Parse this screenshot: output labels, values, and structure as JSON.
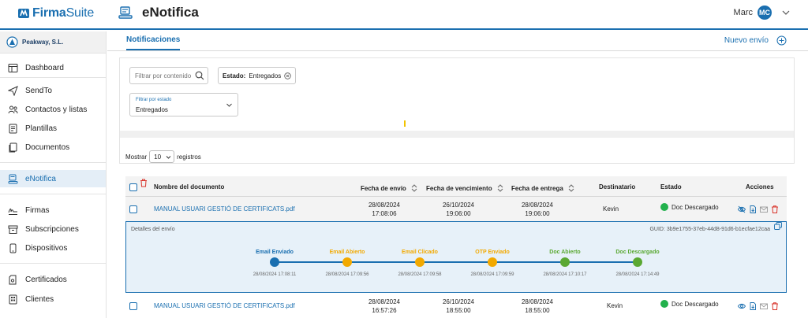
{
  "brand": {
    "name_bold": "Firma",
    "name_light": "Suite",
    "color": "#1a6fb0"
  },
  "header": {
    "title": "eNotifica",
    "user": "Marc",
    "user_initials": "MC"
  },
  "sidebar": {
    "company": "Peakway, S.L.",
    "items": [
      {
        "label": "Dashboard",
        "icon": "dashboard-icon"
      },
      {
        "label": "SendTo",
        "icon": "send-icon"
      },
      {
        "label": "Contactos y listas",
        "icon": "contacts-icon"
      },
      {
        "label": "Plantillas",
        "icon": "template-icon"
      },
      {
        "label": "Documentos",
        "icon": "documents-icon"
      },
      {
        "label": "eNotifica",
        "icon": "enotifica-icon",
        "active": true
      },
      {
        "label": "Firmas",
        "icon": "signature-icon"
      },
      {
        "label": "Subscripciones",
        "icon": "subscriptions-icon"
      },
      {
        "label": "Dispositivos",
        "icon": "device-icon"
      },
      {
        "label": "Certificados",
        "icon": "certificate-icon"
      },
      {
        "label": "Clientes",
        "icon": "clients-icon"
      }
    ]
  },
  "tabs": {
    "active": "Notificaciones",
    "new_send": "Nuevo envío"
  },
  "filters": {
    "search_placeholder": "Filtrar por contenido",
    "chip_key": "Estado:",
    "chip_value": "Entregados",
    "state_label": "Filtrar por estado",
    "state_value": "Entregados"
  },
  "length": {
    "prefix": "Mostrar",
    "value": "10",
    "suffix": "registros"
  },
  "table": {
    "columns": {
      "name": "Nombre del documento",
      "sent": "Fecha de envío",
      "due": "Fecha de vencimiento",
      "delivered": "Fecha de entrega",
      "recipient": "Destinatario",
      "state": "Estado",
      "actions": "Acciones"
    },
    "rows": [
      {
        "name": "MANUAL USUARI GESTIÓ DE CERTIFICATS.pdf",
        "sent_date": "28/08/2024",
        "sent_time": "17:08:06",
        "due_date": "26/10/2024",
        "due_time": "19:06:00",
        "delivered_date": "28/08/2024",
        "delivered_time": "19:06:00",
        "recipient": "Kevin",
        "state": "Doc Descargado"
      },
      {
        "name": "MANUAL USUARI GESTIÓ DE CERTIFICATS.pdf",
        "sent_date": "28/08/2024",
        "sent_time": "16:57:26",
        "due_date": "26/10/2024",
        "due_time": "18:55:00",
        "delivered_date": "28/08/2024",
        "delivered_time": "18:55:00",
        "recipient": "Kevin",
        "state": "Doc Descargado"
      }
    ]
  },
  "detail": {
    "title": "Detalles del envío",
    "guid": "GUID: 3b9e1755-37eb-44d8-91d6-b1ecfae12caa",
    "steps": [
      {
        "label": "Email Enviado",
        "date": "28/08/2024 17:08:11",
        "color": "#1a6fb0"
      },
      {
        "label": "Email Abierto",
        "date": "28/08/2024 17:09:56",
        "color": "#f2a900"
      },
      {
        "label": "Email Clicado",
        "date": "28/08/2024 17:09:58",
        "color": "#f2a900"
      },
      {
        "label": "OTP Enviado",
        "date": "28/08/2024 17:09:59",
        "color": "#f2a900"
      },
      {
        "label": "Doc Abierto",
        "date": "28/08/2024 17:10:17",
        "color": "#5aa832"
      },
      {
        "label": "Doc Descargado",
        "date": "28/08/2024 17:14:49",
        "color": "#5aa832"
      }
    ]
  }
}
